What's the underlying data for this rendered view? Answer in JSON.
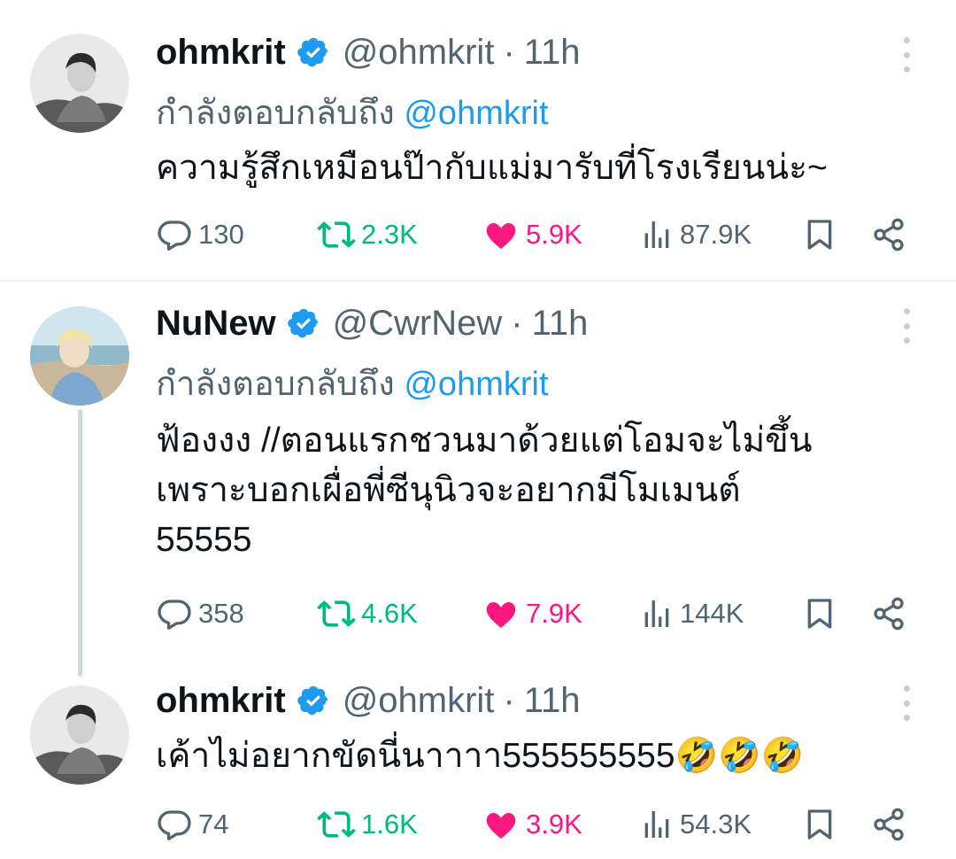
{
  "colors": {
    "accent": "#1d9bf0",
    "retweet": "#00ba7c",
    "like": "#f91880",
    "muted": "#536471"
  },
  "tweets": [
    {
      "name": "ohmkrit",
      "verified": true,
      "handle": "@ohmkrit",
      "dot": "·",
      "time": "11h",
      "reply_prefix": "กำลังตอบกลับถึง",
      "reply_to": "@ohmkrit",
      "text": "ความรู้สึกเหมือนป๊ากับแม่มารับที่โรงเรียนน่ะ~",
      "stats": {
        "replies": "130",
        "retweets": "2.3K",
        "likes": "5.9K",
        "views": "87.9K"
      },
      "liked": true
    },
    {
      "name": "NuNew",
      "verified": true,
      "handle": "@CwrNew",
      "dot": "·",
      "time": "11h",
      "reply_prefix": "กำลังตอบกลับถึง",
      "reply_to": "@ohmkrit",
      "text": "ฟ้องงง //ตอนแรกชวนมาด้วยแต่โอมจะไม่ขึ้น\nเพราะบอกเผื่อพี่ซีนุนิวจะอยากมีโมเมนต์\n55555",
      "stats": {
        "replies": "358",
        "retweets": "4.6K",
        "likes": "7.9K",
        "views": "144K"
      },
      "liked": true
    },
    {
      "name": "ohmkrit",
      "verified": true,
      "handle": "@ohmkrit",
      "dot": "·",
      "time": "11h",
      "text": "เค้าไม่อยากขัดนี่นาาาา555555555🤣🤣🤣",
      "stats": {
        "replies": "74",
        "retweets": "1.6K",
        "likes": "3.9K",
        "views": "54.3K"
      },
      "liked": true
    }
  ]
}
